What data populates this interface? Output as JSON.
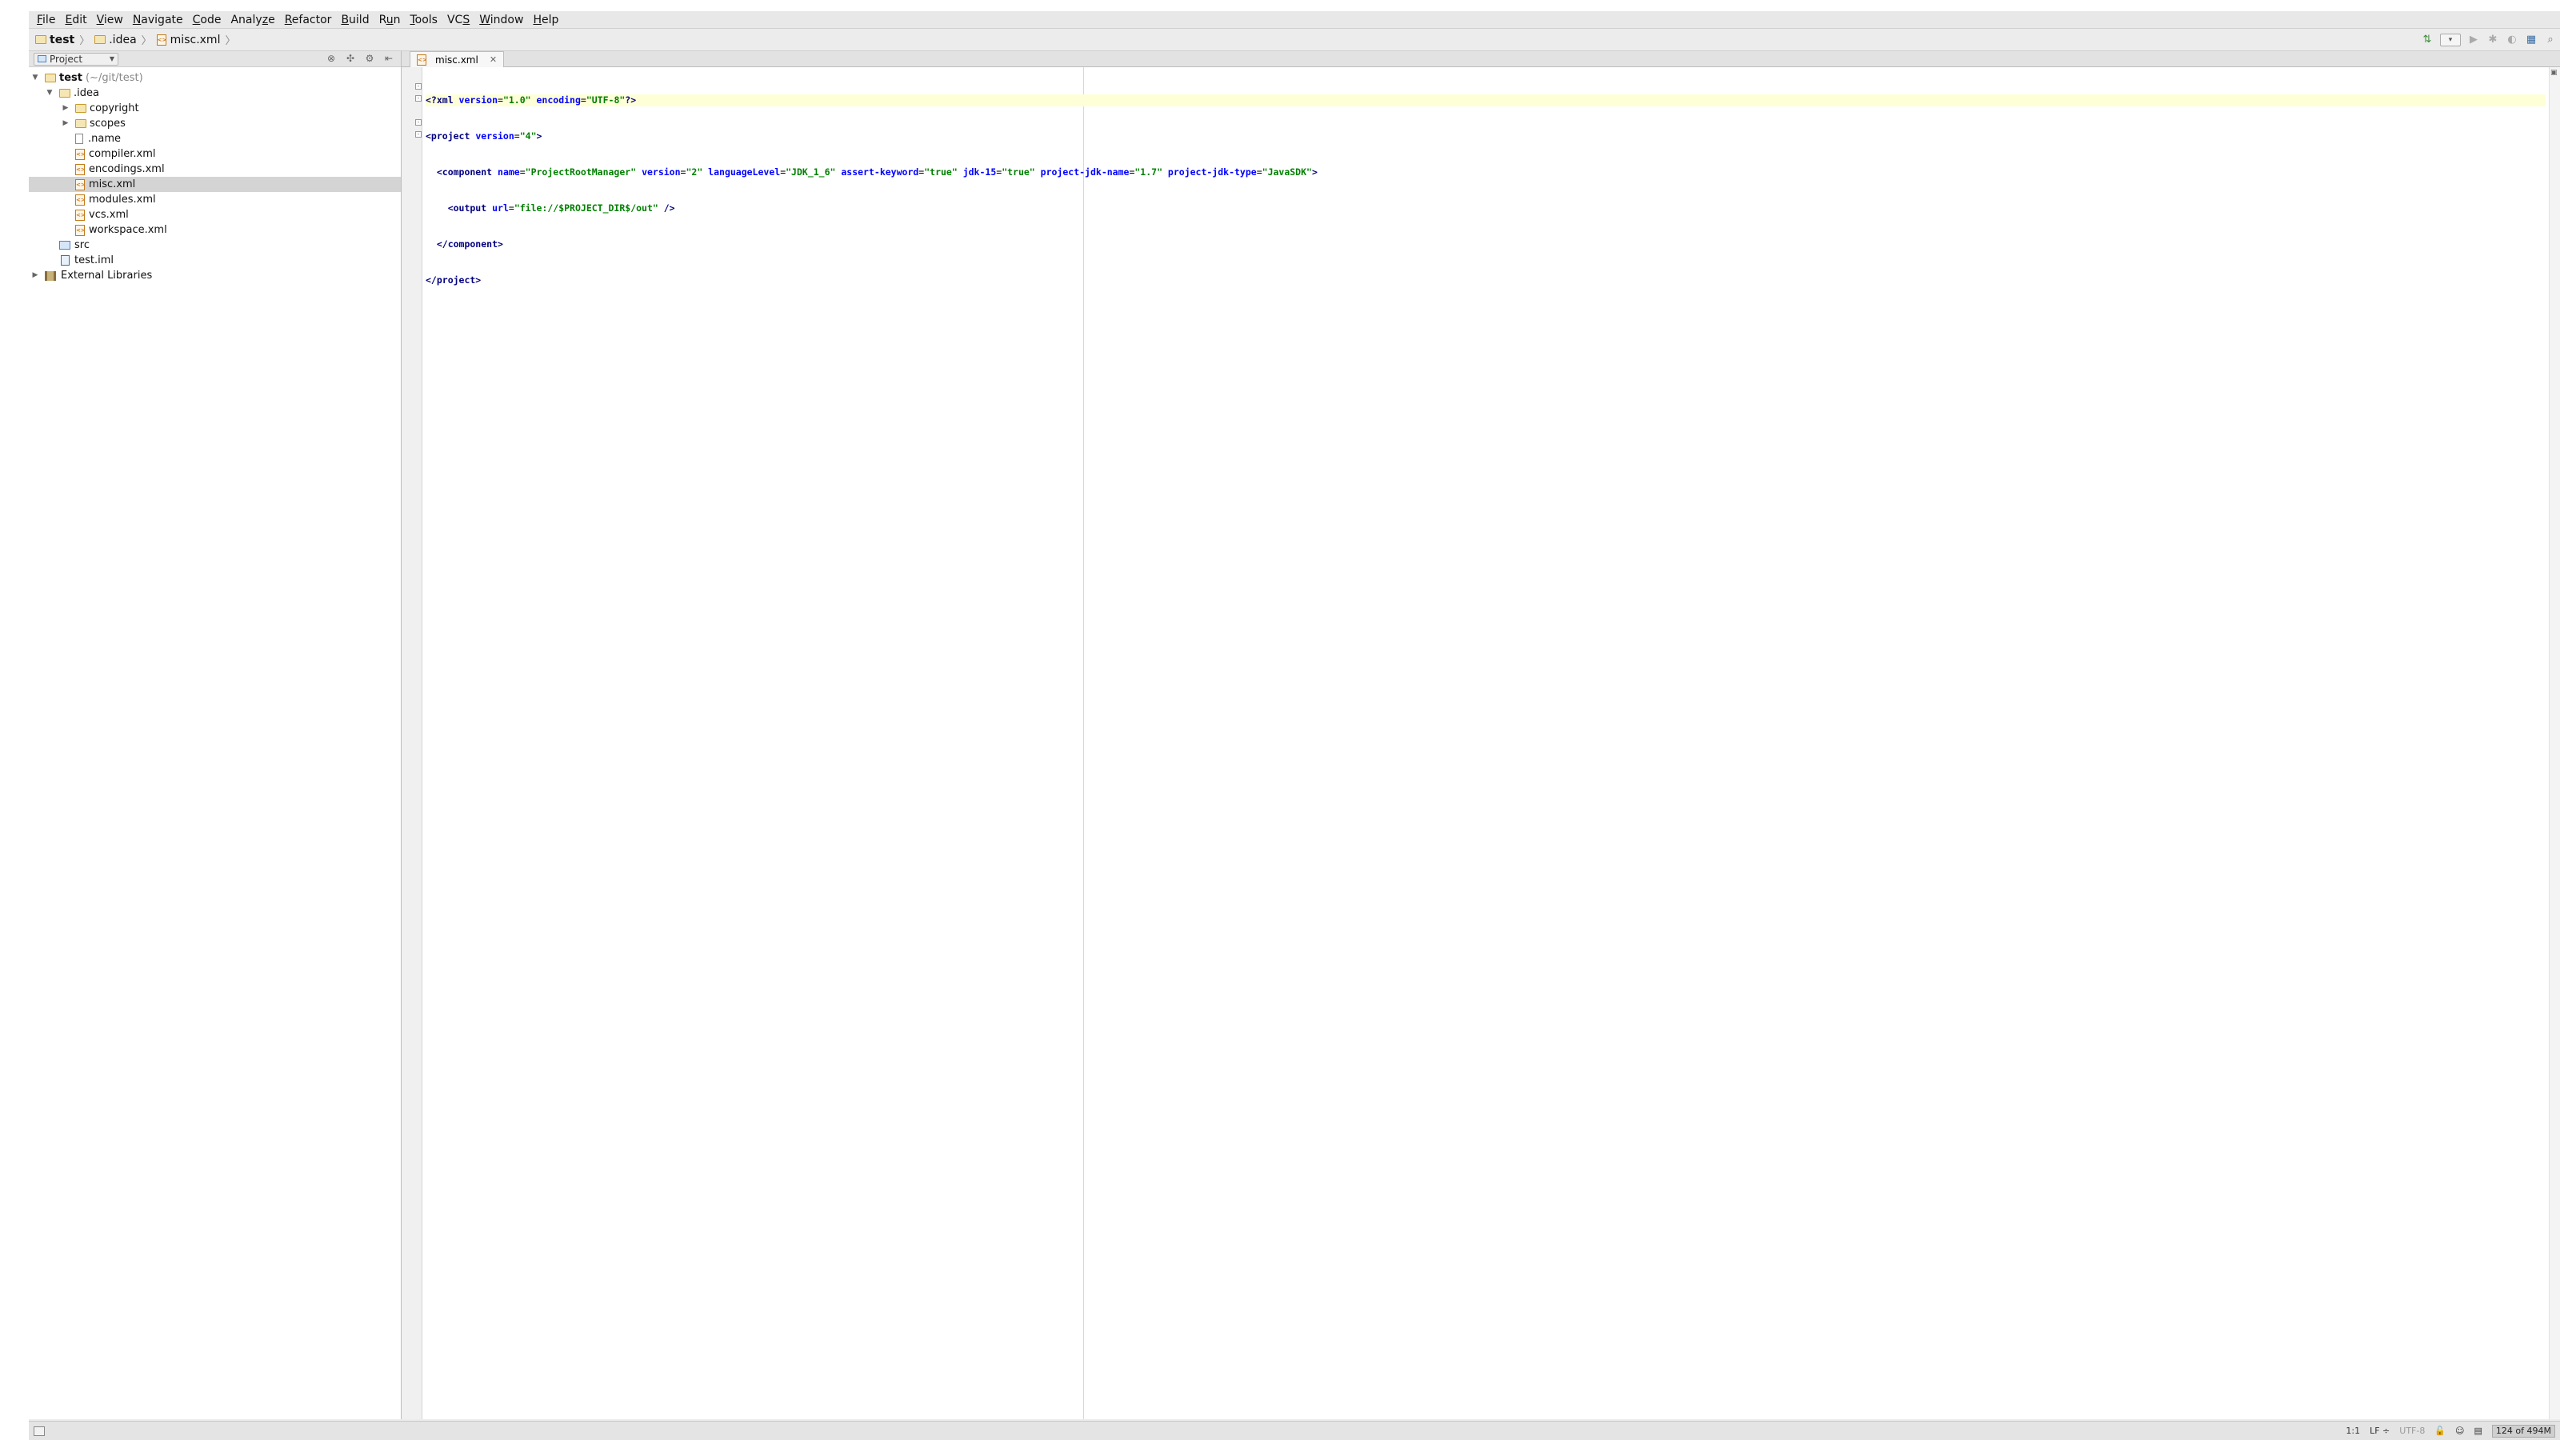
{
  "menubar": {
    "items": [
      {
        "u": "F",
        "rest": "ile"
      },
      {
        "u": "E",
        "rest": "dit"
      },
      {
        "u": "V",
        "rest": "iew"
      },
      {
        "u": "N",
        "rest": "avigate"
      },
      {
        "u": "C",
        "rest": "ode"
      },
      {
        "pre": "Analy",
        "u": "z",
        "rest": "e"
      },
      {
        "u": "R",
        "rest": "efactor"
      },
      {
        "u": "B",
        "rest": "uild"
      },
      {
        "pre": "R",
        "u": "u",
        "rest": "n"
      },
      {
        "u": "T",
        "rest": "ools"
      },
      {
        "pre": "VC",
        "u": "S",
        "rest": ""
      },
      {
        "u": "W",
        "rest": "indow"
      },
      {
        "u": "H",
        "rest": "elp"
      }
    ]
  },
  "breadcrumb": {
    "project": "test",
    "folder": ".idea",
    "file": "misc.xml",
    "sep": "〉"
  },
  "project_panel": {
    "view_label": "Project",
    "tree": {
      "root": {
        "name": "test",
        "path": "(~/git/test)"
      },
      "idea": ".idea",
      "copyright": "copyright",
      "scopes": "scopes",
      "name_file": ".name",
      "compiler": "compiler.xml",
      "encodings": "encodings.xml",
      "misc": "misc.xml",
      "modules": "modules.xml",
      "vcs": "vcs.xml",
      "workspace": "workspace.xml",
      "src": "src",
      "iml": "test.iml",
      "ext_libs": "External Libraries"
    }
  },
  "editor": {
    "tab_label": "misc.xml",
    "code": {
      "l1": {
        "a": "<?xml ",
        "b": "version",
        "c": "=",
        "d": "\"1.0\"",
        "e": " encoding",
        "f": "=",
        "g": "\"UTF-8\"",
        "h": "?>"
      },
      "l2": {
        "a": "<project ",
        "b": "version",
        "c": "=",
        "d": "\"4\"",
        "e": ">"
      },
      "l3": {
        "a": "  <component ",
        "b": "name",
        "c": "=",
        "d": "\"ProjectRootManager\"",
        "e": " version",
        "f": "=",
        "g": "\"2\"",
        "h": " languageLevel",
        "i": "=",
        "j": "\"JDK_1_6\"",
        "k": " assert-keyword",
        "l": "=",
        "m": "\"true\"",
        "n": " jdk-15",
        "o": "=",
        "p": "\"true\"",
        "q": " project-jdk-name",
        "r": "=",
        "s": "\"1.7\"",
        "t": " project-jdk-type",
        "u": "=",
        "v": "\"JavaSDK\"",
        "w": ">"
      },
      "l4": {
        "a": "    <output ",
        "b": "url",
        "c": "=",
        "d": "\"file://$PROJECT_DIR$/out\"",
        "e": " />"
      },
      "l5": {
        "a": "  </component>"
      },
      "l6": {
        "a": "</project>"
      }
    }
  },
  "statusbar": {
    "position": "1:1",
    "line_sep": "LF ÷",
    "encoding": "UTF-8",
    "memory": "124 of 494M"
  }
}
